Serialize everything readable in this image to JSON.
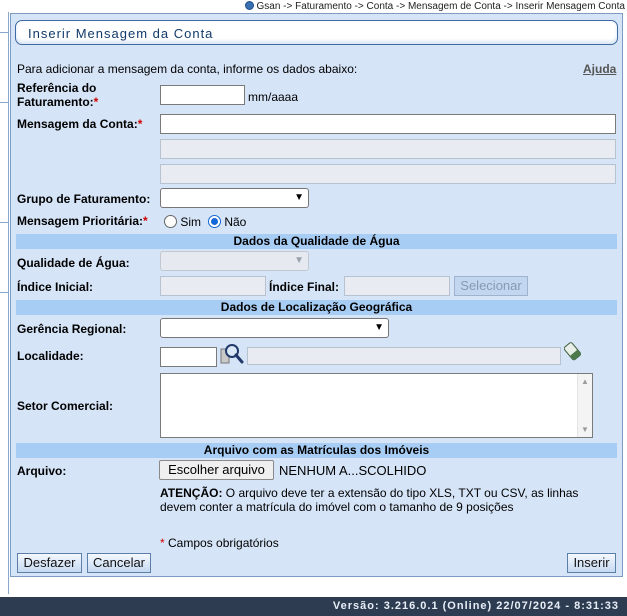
{
  "breadcrumb": "Gsan -> Faturamento -> Conta -> Mensagem de Conta -> Inserir Mensagem Conta",
  "title": "Inserir Mensagem da Conta",
  "intro": "Para adicionar a mensagem da conta, informe os dados abaixo:",
  "help_link": "Ajuda",
  "fields": {
    "referencia_label_1": "Referência do",
    "referencia_label_2": "Faturamento:",
    "referencia_value": "",
    "referencia_hint": "mm/aaaa",
    "mensagem_label": "Mensagem da Conta:",
    "mensagem_line1": "",
    "mensagem_line2": "",
    "mensagem_line3": "",
    "grupo_label": "Grupo de Faturamento:",
    "grupo_value": "",
    "prioritaria_label": "Mensagem Prioritária:",
    "prioritaria_sim": "Sim",
    "prioritaria_nao": "Não",
    "prioritaria_selected": "Não"
  },
  "sections": {
    "qualidade": "Dados da Qualidade de Água",
    "localizacao": "Dados de Localização Geográfica",
    "arquivo": "Arquivo com as Matrículas dos Imóveis"
  },
  "qualidade": {
    "qualidade_label": "Qualidade de Água:",
    "qualidade_value": "",
    "indice_inicial_label": "Índice Inicial:",
    "indice_inicial_value": "",
    "indice_final_label": "Índice Final:",
    "indice_final_value": "",
    "selecionar_button": "Selecionar"
  },
  "localizacao": {
    "gerencia_label": "Gerência Regional:",
    "gerencia_value": "",
    "localidade_label": "Localidade:",
    "localidade_code": "",
    "localidade_name": "",
    "setor_label": "Setor Comercial:"
  },
  "arquivo": {
    "arquivo_label": "Arquivo:",
    "choose_button": "Escolher arquivo",
    "file_name": "NENHUM A...SCOLHIDO",
    "warning_title": "ATENÇÃO:",
    "warning_text_1": " O arquivo deve ter a extensão do tipo XLS, TXT ou CSV, as linhas",
    "warning_text_2": "devem conter a matrícula do imóvel com o tamanho de 9 posições"
  },
  "required_note": "Campos obrigatórios",
  "required_mark": "*",
  "buttons": {
    "desfazer": "Desfazer",
    "cancelar": "Cancelar",
    "inserir": "Inserir"
  },
  "footer": "Versão: 3.216.0.1 (Online) 22/07/2024 - 8:31:33",
  "colors": {
    "panel_bg": "#d5e4f7",
    "section_bg": "#a8cdf5",
    "footer_bg": "#2e3c52",
    "title_text": "#113a6b"
  },
  "icons": {
    "search": "magnifier-icon",
    "clear": "eraser-icon",
    "breadcrumb": "bullet-icon"
  }
}
